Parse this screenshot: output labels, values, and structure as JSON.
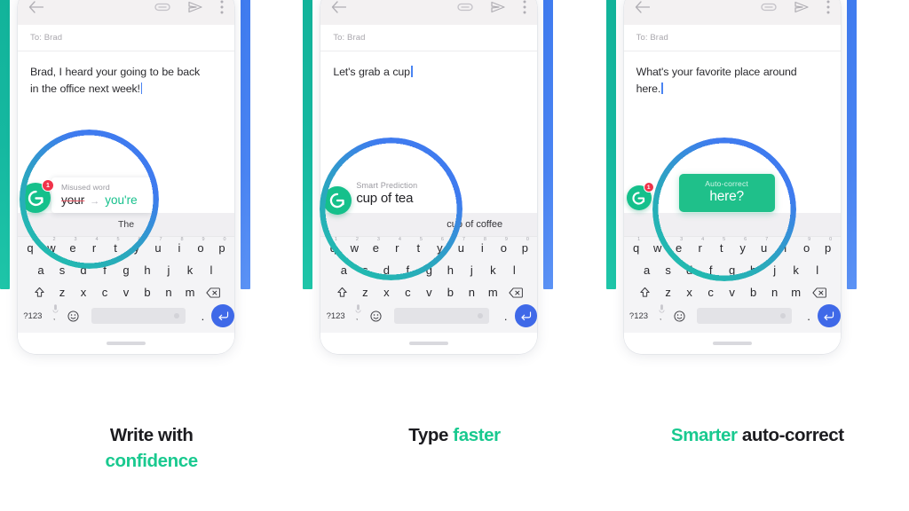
{
  "meta": {
    "accent_teal": "#14b89e",
    "accent_blue": "#4a84f2",
    "brand_green": "#19c98f",
    "caret_blue": "#4a84f2",
    "error_red": "#e8525f",
    "badge_red": "#f0334a"
  },
  "app_header": {
    "back_icon": "back-arrow-icon",
    "attach_icon": "paperclip-icon",
    "send_icon": "send-arrow-icon",
    "overflow_icon": "more-vertical-icon"
  },
  "keyboard": {
    "row1": [
      {
        "letter": "q",
        "num": "1"
      },
      {
        "letter": "w",
        "num": "2"
      },
      {
        "letter": "e",
        "num": "3"
      },
      {
        "letter": "r",
        "num": "4"
      },
      {
        "letter": "t",
        "num": "5"
      },
      {
        "letter": "y",
        "num": "6"
      },
      {
        "letter": "u",
        "num": "7"
      },
      {
        "letter": "i",
        "num": "8"
      },
      {
        "letter": "o",
        "num": "9"
      },
      {
        "letter": "p",
        "num": "0"
      }
    ],
    "row2": [
      "a",
      "s",
      "d",
      "f",
      "g",
      "h",
      "j",
      "k",
      "l"
    ],
    "row3": [
      "z",
      "x",
      "c",
      "v",
      "b",
      "n",
      "m"
    ],
    "shift_icon": "shift-up-arrow-icon",
    "backspace_icon": "backspace-delete-icon",
    "symbols_key": "?123",
    "comma_key": ",",
    "mic_icon": "microphone-icon",
    "emoji_icon": "smiley-face-icon",
    "spacebar": "space-bar",
    "period_key": ".",
    "enter_icon": "enter-return-icon",
    "home_indicator": "home-indicator-bar"
  },
  "panels": [
    {
      "id": "panel-write-with-confidence",
      "to_label": "To: Brad",
      "message_lines": [
        "Brad, I heard your going to be back",
        "in the office next week!"
      ],
      "suggestions": [
        "The"
      ],
      "callout": {
        "kind": "grammar-card",
        "title": "Misused word",
        "wrong_word": "your",
        "arrow": "→",
        "correct_word": "you're",
        "logo": "grammarly-g-logo",
        "badge_count": "1"
      },
      "caption": {
        "line1": "Write with",
        "line1_color": "dark",
        "line2": "confidence",
        "line2_color": "green"
      }
    },
    {
      "id": "panel-type-faster",
      "to_label": "To: Brad",
      "message_lines": [
        "Let's grab a cup"
      ],
      "suggestions": [],
      "callout": {
        "kind": "smart-prediction",
        "title": "Smart Prediction",
        "primary": "cup of tea",
        "alternate": "cup of coffee",
        "logo": "grammarly-g-logo",
        "badge_count": ""
      },
      "caption": {
        "line1": "Type ",
        "line1_color": "dark",
        "line2": "faster",
        "line2_color": "green",
        "inline": true
      }
    },
    {
      "id": "panel-smarter-auto-correct",
      "to_label": "To: Brad",
      "message_lines": [
        "What's your favorite place around",
        "here."
      ],
      "suggestions": [],
      "callout": {
        "kind": "auto-correct",
        "title": "Auto-correct",
        "primary": "here?",
        "logo": "grammarly-g-logo",
        "badge_count": "1"
      },
      "caption": {
        "line1": "Smarter ",
        "line1_color": "green",
        "line2": "auto-correct",
        "line2_color": "dark",
        "inline": true
      }
    }
  ]
}
